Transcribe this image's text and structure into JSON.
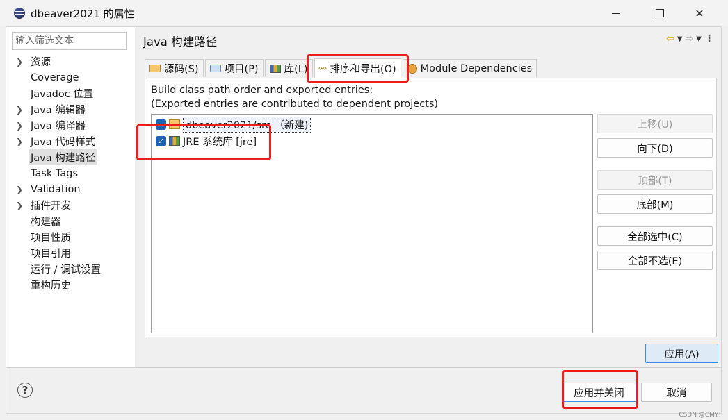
{
  "window": {
    "title": "dbeaver2021 的属性",
    "minimize_glyph": "",
    "close_glyph": "✕"
  },
  "nav": {
    "filter_placeholder": "输入筛选文本",
    "items": [
      {
        "label": "资源",
        "expandable": true
      },
      {
        "label": "Coverage",
        "expandable": false
      },
      {
        "label": "Javadoc 位置",
        "expandable": false
      },
      {
        "label": "Java 编辑器",
        "expandable": true
      },
      {
        "label": "Java 编译器",
        "expandable": true
      },
      {
        "label": "Java 代码样式",
        "expandable": true
      },
      {
        "label": "Java 构建路径",
        "expandable": false,
        "selected": true
      },
      {
        "label": "Task Tags",
        "expandable": false
      },
      {
        "label": "Validation",
        "expandable": true
      },
      {
        "label": "插件开发",
        "expandable": true
      },
      {
        "label": "构建器",
        "expandable": false
      },
      {
        "label": "项目性质",
        "expandable": false
      },
      {
        "label": "项目引用",
        "expandable": false
      },
      {
        "label": "运行 / 调试设置",
        "expandable": false
      },
      {
        "label": "重构历史",
        "expandable": false
      }
    ]
  },
  "page": {
    "title": "Java 构建路径",
    "tabs": [
      {
        "label": "源码(S)",
        "icon": "source-folder-icon"
      },
      {
        "label": "项目(P)",
        "icon": "project-icon"
      },
      {
        "label": "库(L)",
        "icon": "library-icon"
      },
      {
        "label": "排序和导出(O)",
        "icon": "order-export-icon",
        "active": true
      },
      {
        "label": "Module Dependencies",
        "icon": "module-icon"
      }
    ],
    "description_line1": "Build class path order and exported entries:",
    "description_line2": "(Exported entries are contributed to dependent projects)",
    "entries": [
      {
        "label": "dbeaver2021/src （新建)",
        "state": "partial"
      },
      {
        "label": "JRE 系统库 [jre]",
        "state": "checked"
      }
    ],
    "buttons": {
      "up": "上移(U)",
      "down": "向下(D)",
      "top": "顶部(T)",
      "bottom": "底部(M)",
      "select_all": "全部选中(C)",
      "deselect_all": "全部不选(E)",
      "apply": "应用(A)"
    }
  },
  "footer": {
    "help": "?",
    "apply_close": "应用并关闭",
    "cancel": "取消"
  },
  "watermark": "CSDN @CMY!"
}
